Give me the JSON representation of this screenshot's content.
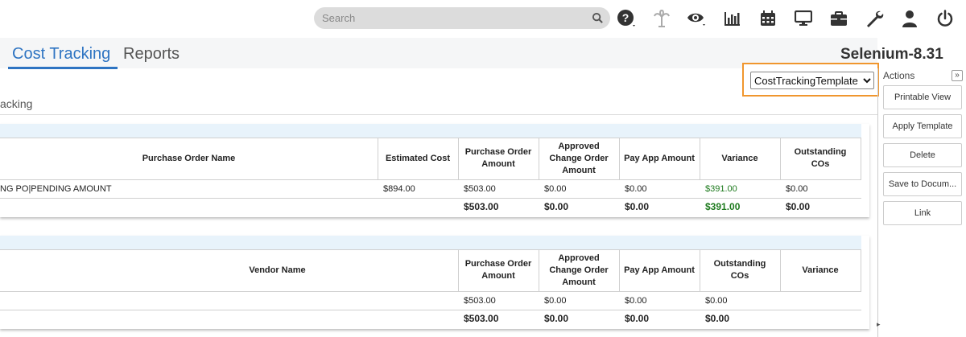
{
  "search": {
    "placeholder": "Search"
  },
  "toolbar": {
    "icons": [
      "help-icon",
      "palm-tree-icon",
      "eye-icon",
      "bar-chart-icon",
      "calendar-icon",
      "monitor-icon",
      "briefcase-icon",
      "wrench-icon",
      "user-icon",
      "power-icon"
    ]
  },
  "tabs": [
    {
      "label": "Cost Tracking",
      "active": true
    },
    {
      "label": "Reports",
      "active": false
    }
  ],
  "project_name": "Selenium-8.31",
  "template_select": {
    "value": "CostTrackingTemplate"
  },
  "section_label": "acking",
  "po_table": {
    "headers": {
      "name": "Purchase Order Name",
      "estimated": "Estimated Cost",
      "po_amount": "Purchase Order Amount",
      "approved": "Approved Change Order Amount",
      "payapp": "Pay App Amount",
      "variance": "Variance",
      "outstanding": "Outstanding COs"
    },
    "row": {
      "name": "NG PO|PENDING AMOUNT",
      "estimated": "$894.00",
      "po_amount": "$503.00",
      "approved": "$0.00",
      "payapp": "$0.00",
      "variance": "$391.00",
      "outstanding": "$0.00"
    },
    "totals": {
      "po_amount": "$503.00",
      "approved": "$0.00",
      "payapp": "$0.00",
      "variance": "$391.00",
      "outstanding": "$0.00"
    }
  },
  "vendor_table": {
    "headers": {
      "name": "Vendor Name",
      "po_amount": "Purchase Order Amount",
      "approved": "Approved Change Order Amount",
      "payapp": "Pay App Amount",
      "outstanding": "Outstanding COs",
      "variance": "Variance"
    },
    "row": {
      "po_amount": "$503.00",
      "approved": "$0.00",
      "payapp": "$0.00",
      "outstanding": "$0.00"
    },
    "totals": {
      "po_amount": "$503.00",
      "approved": "$0.00",
      "payapp": "$0.00",
      "outstanding": "$0.00"
    }
  },
  "actions": {
    "title": "Actions",
    "collapse_label": "»",
    "buttons": [
      "Printable View",
      "Apply Template",
      "Delete",
      "Save to Docum...",
      "Link"
    ]
  },
  "colors": {
    "accent": "#2e74c2",
    "highlight": "#f0962e",
    "positive": "#1d7a1d",
    "band": "#e8f3fb"
  }
}
